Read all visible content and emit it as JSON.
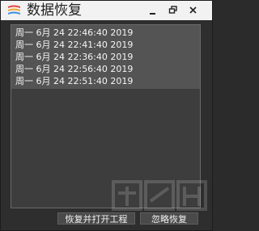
{
  "window": {
    "title": "数据恢复",
    "controls": {
      "minimize": "minimize-icon",
      "maximize": "restore-icon",
      "close": "close-icon"
    }
  },
  "backups": [
    "周一 6月 24 22:46:40 2019",
    "周一 6月 24 22:41:40 2019",
    "周一 6月 24 22:36:40 2019",
    "周一 6月 24 22:56:40 2019",
    "周一 6月 24 22:51:40 2019"
  ],
  "buttons": {
    "restore_open": "恢复并打开工程",
    "ignore": "忽略恢复"
  },
  "colors": {
    "titlebar": "#f2f2f2",
    "window_bg": "#2e2e2e",
    "list_bg": "#3d3d3d",
    "list_selected": "#545454",
    "text": "#f5f5f5"
  }
}
